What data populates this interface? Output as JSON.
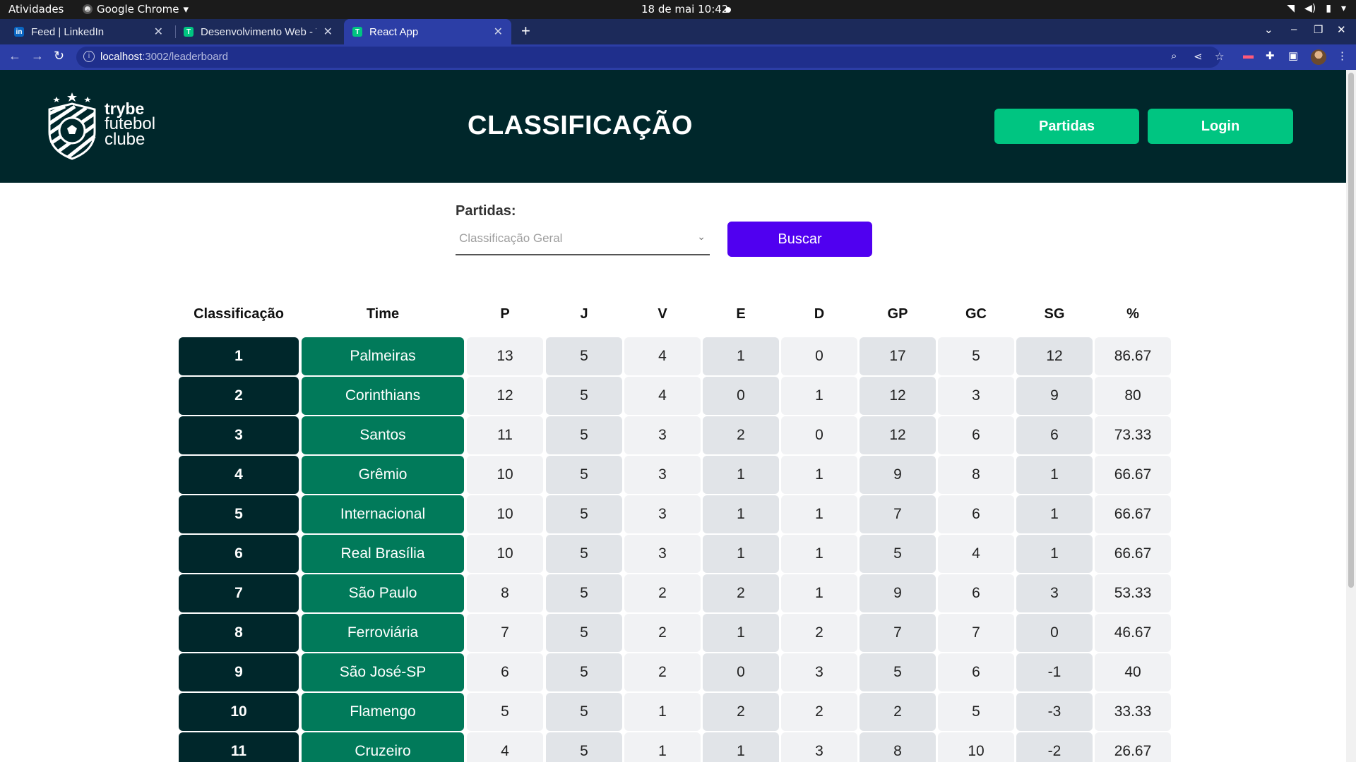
{
  "os": {
    "activities": "Atividades",
    "app_name": "Google Chrome",
    "clock": "18 de mai  10:42"
  },
  "browser": {
    "tabs": [
      {
        "title": "Feed | LinkedIn",
        "favicon": "in"
      },
      {
        "title": "Desenvolvimento Web - Tr",
        "favicon": "T"
      },
      {
        "title": "React App",
        "favicon": "T"
      }
    ],
    "url_host": "localhost",
    "url_path": ":3002/leaderboard"
  },
  "header": {
    "logo_line1": "trybe",
    "logo_line2": "futebol",
    "logo_line3": "clube",
    "title": "CLASSIFICAÇÃO",
    "matches_button": "Partidas",
    "login_button": "Login"
  },
  "filter": {
    "label": "Partidas:",
    "selected": "Classificação Geral",
    "search_button": "Buscar"
  },
  "table": {
    "columns": [
      "Classificação",
      "Time",
      "P",
      "J",
      "V",
      "E",
      "D",
      "GP",
      "GC",
      "SG",
      "%"
    ],
    "rows": [
      [
        "1",
        "Palmeiras",
        "13",
        "5",
        "4",
        "1",
        "0",
        "17",
        "5",
        "12",
        "86.67"
      ],
      [
        "2",
        "Corinthians",
        "12",
        "5",
        "4",
        "0",
        "1",
        "12",
        "3",
        "9",
        "80"
      ],
      [
        "3",
        "Santos",
        "11",
        "5",
        "3",
        "2",
        "0",
        "12",
        "6",
        "6",
        "73.33"
      ],
      [
        "4",
        "Grêmio",
        "10",
        "5",
        "3",
        "1",
        "1",
        "9",
        "8",
        "1",
        "66.67"
      ],
      [
        "5",
        "Internacional",
        "10",
        "5",
        "3",
        "1",
        "1",
        "7",
        "6",
        "1",
        "66.67"
      ],
      [
        "6",
        "Real Brasília",
        "10",
        "5",
        "3",
        "1",
        "1",
        "5",
        "4",
        "1",
        "66.67"
      ],
      [
        "7",
        "São Paulo",
        "8",
        "5",
        "2",
        "2",
        "1",
        "9",
        "6",
        "3",
        "53.33"
      ],
      [
        "8",
        "Ferroviária",
        "7",
        "5",
        "2",
        "1",
        "2",
        "7",
        "7",
        "0",
        "46.67"
      ],
      [
        "9",
        "São José-SP",
        "6",
        "5",
        "2",
        "0",
        "3",
        "5",
        "6",
        "-1",
        "40"
      ],
      [
        "10",
        "Flamengo",
        "5",
        "5",
        "1",
        "2",
        "2",
        "2",
        "5",
        "-3",
        "33.33"
      ],
      [
        "11",
        "Cruzeiro",
        "4",
        "5",
        "1",
        "1",
        "3",
        "8",
        "10",
        "-2",
        "26.67"
      ]
    ]
  },
  "colors": {
    "header_bg": "#00272b",
    "accent_green": "#00c581",
    "team_green": "#017a5a",
    "search_purple": "#5000f0"
  }
}
